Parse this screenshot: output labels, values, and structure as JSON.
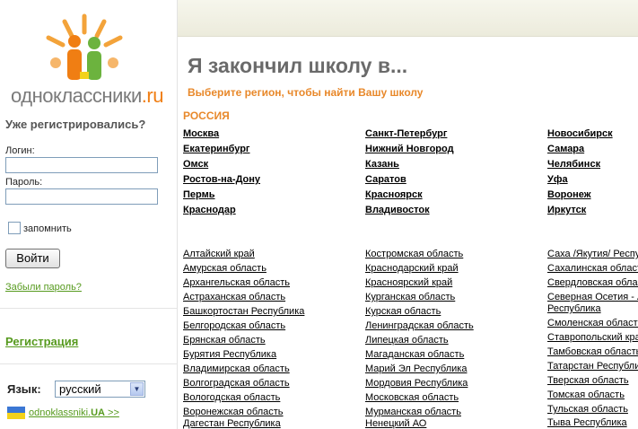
{
  "sidebar": {
    "logo_text": "одноклассники",
    "logo_suffix": ".ru",
    "login_title": "Уже регистрировались?",
    "login_label": "Логин:",
    "password_label": "Пароль:",
    "remember_label": "запомнить",
    "login_button": "Войти",
    "forgot_link": "Забыли пароль?",
    "register_link": "Регистрация",
    "language_label": "Язык:",
    "language_selected": "русский",
    "ua_link_text": "odnoklassniki.",
    "ua_link_bold": "UA",
    "ua_link_suffix": " >>"
  },
  "main": {
    "title": "Я закончил школу в...",
    "subtitle": "Выберите регион, чтобы найти Вашу школу",
    "country": "РОССИЯ",
    "cities": [
      [
        "Москва",
        "Санкт-Петербург",
        "Новосибирск"
      ],
      [
        "Екатеринбург",
        "Нижний Новгород",
        "Самара"
      ],
      [
        "Омск",
        "Казань",
        "Челябинск"
      ],
      [
        "Ростов-на-Дону",
        "Саратов",
        "Уфа"
      ],
      [
        "Пермь",
        "Красноярск",
        "Воронеж"
      ],
      [
        "Краснодар",
        "Владивосток",
        "Иркутск"
      ]
    ],
    "regions": [
      [
        "Алтайский край",
        "Костромская область",
        "Саха /Якутия/ Республика"
      ],
      [
        "Амурская область",
        "Краснодарский край",
        "Сахалинская область"
      ],
      [
        "Архангельская область",
        "Красноярский край",
        "Свердловская область"
      ],
      [
        "Астраханская область",
        "Курганская область",
        "Северная Осетия - Алания"
      ],
      [
        "Башкортостан Республика",
        "Курская область",
        "Республика"
      ],
      [
        "Белгородская область",
        "Ленинградская область",
        "Смоленская область"
      ],
      [
        "Брянская область",
        "Липецкая область",
        "Ставропольский край"
      ],
      [
        "Бурятия Республика",
        "Магаданская область",
        "Тамбовская область"
      ],
      [
        "Владимирская область",
        "Марий Эл Республика",
        "Татарстан Республика"
      ],
      [
        "Волгоградская область",
        "Мордовия Республика",
        "Тверская область"
      ],
      [
        "Вологодская область",
        "Московская область",
        "Томская область"
      ],
      [
        "Воронежская область",
        "Мурманская область",
        "Тульская область"
      ],
      [
        "Дагестан Республика",
        "Ненецкий АО",
        "Тыва Республика"
      ]
    ]
  }
}
